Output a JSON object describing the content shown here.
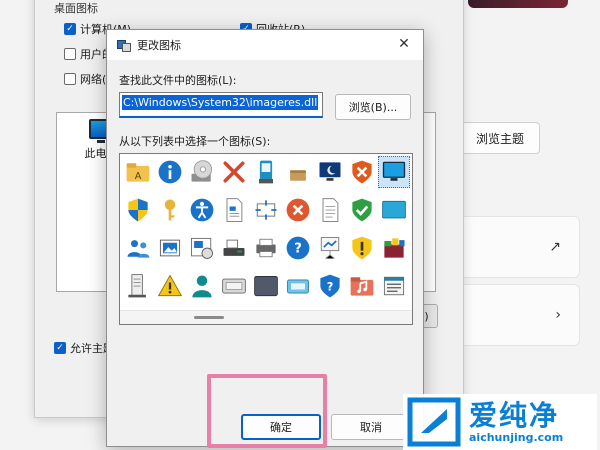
{
  "background": {
    "group_label": "桌面图标",
    "checkboxes": [
      {
        "label": "计算机(M)",
        "checked": true
      },
      {
        "label": "回收站(R)",
        "checked": true
      },
      {
        "label": "用户的",
        "checked": false
      },
      {
        "label": "网络(",
        "checked": false
      }
    ],
    "preview_item_label": "此电脑",
    "allow_themes_label": "允许主题",
    "browse_theme_label": "浏览主题",
    "behind_button_label": "S)",
    "external_link_icon": "external-link-icon",
    "chevron_icon": "chevron-right-icon"
  },
  "dialog": {
    "title": "更改图标",
    "find_label": "查找此文件中的图标(L):",
    "path_value": "C:\\Windows\\System32\\imageres.dll",
    "browse_label": "浏览(B)...",
    "select_label": "从以下列表中选择一个图标(S):",
    "ok_label": "确定",
    "cancel_label": "取消",
    "selected_icon": "monitor-icon",
    "icons": [
      [
        "folder-a-icon",
        "info-icon",
        "cd-drive-icon",
        "red-x-icon",
        "usb-drive-icon",
        "box-icon",
        "night-monitor-icon",
        "shield-x-icon",
        "monitor-icon"
      ],
      [
        "uac-shield-icon",
        "key-icon",
        "accessibility-icon",
        "document-icon",
        "resize-icon",
        "red-circle-x-icon",
        "blank-document-icon",
        "green-shield-check-icon",
        "teal-screen-icon"
      ],
      [
        "users-icon",
        "picture-icon",
        "image-frame-icon",
        "scanner-icon",
        "printer-icon",
        "question-icon",
        "presentation-icon",
        "yellow-shield-icon",
        "windows-apps-icon"
      ],
      [
        "server-icon",
        "warning-icon",
        "user-icon",
        "hardware-board-icon",
        "dark-board-icon",
        "window-icon",
        "blue-shield-question-icon",
        "music-folder-icon",
        "list-window-icon"
      ]
    ]
  },
  "watermark": {
    "brand": "爱纯净",
    "url": "aichunjing.com"
  }
}
